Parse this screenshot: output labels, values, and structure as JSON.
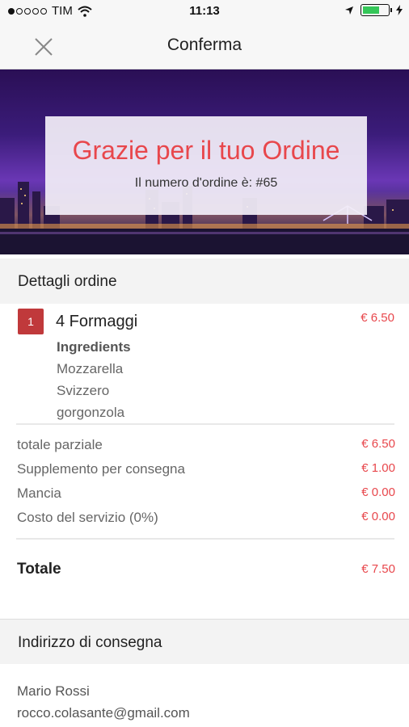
{
  "status_bar": {
    "carrier": "TIM",
    "time": "11:13",
    "signal_bars_filled": 1,
    "signal_bars_total": 5
  },
  "nav": {
    "title": "Conferma",
    "close_icon": "close-icon"
  },
  "hero": {
    "heading": "Grazie per il tuo Ordine",
    "order_number_text": "Il numero d'ordine è: #65"
  },
  "order_details": {
    "header": "Dettagli ordine",
    "item": {
      "quantity": "1",
      "name": "4 Formaggi",
      "price": "€ 6.50",
      "ingredients_label": "Ingredients",
      "ingredients": [
        "Mozzarella",
        "Svizzero",
        "gorgonzola"
      ]
    },
    "summary": [
      {
        "label": "totale parziale",
        "value": "€ 6.50"
      },
      {
        "label": "Supplemento per consegna",
        "value": "€ 1.00"
      },
      {
        "label": "Mancia",
        "value": "€ 0.00"
      },
      {
        "label": "Costo del servizio (0%)",
        "value": "€ 0.00"
      }
    ],
    "total_label": "Totale",
    "total_value": "€ 7.50"
  },
  "delivery": {
    "header": "Indirizzo di consegna",
    "name": "Mario Rossi",
    "email": "rocco.colasante@gmail.com"
  },
  "colors": {
    "accent_red": "#e8474c",
    "badge_red": "#c0393b",
    "battery_green": "#35c759"
  }
}
